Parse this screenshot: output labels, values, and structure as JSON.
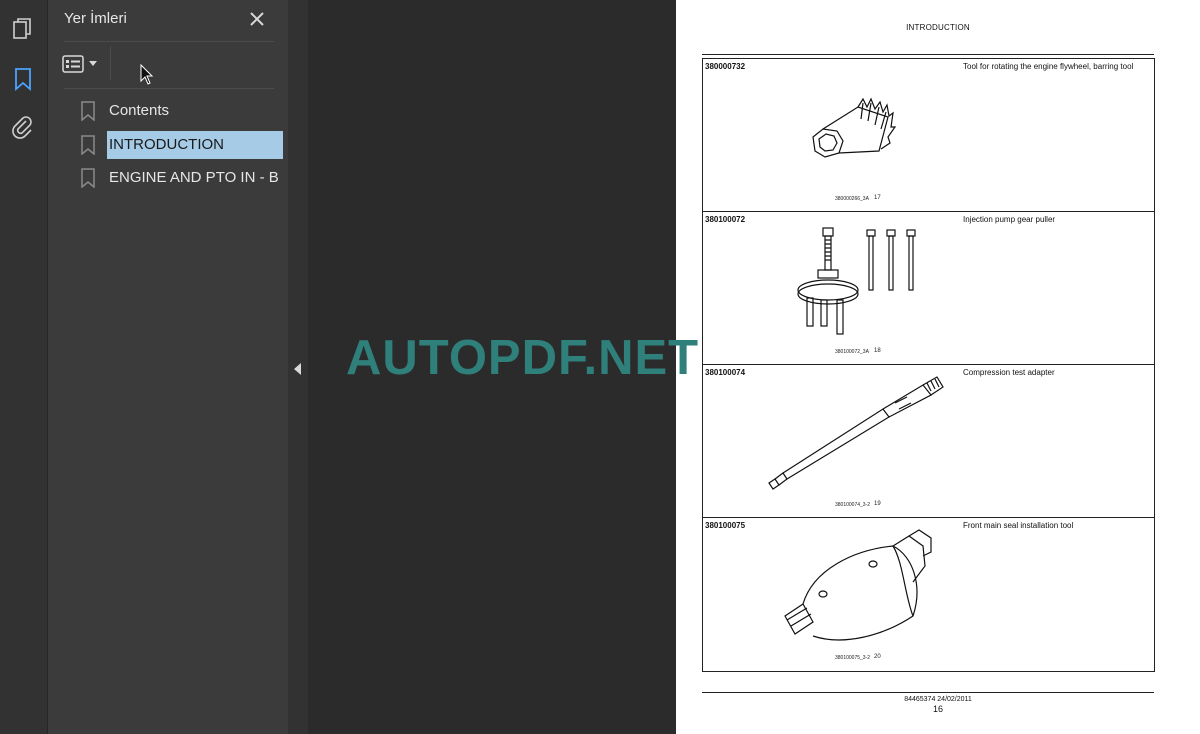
{
  "sidebar_rail": {
    "icons": [
      "pages-icon",
      "bookmark-icon",
      "paperclip-icon"
    ],
    "active": "bookmark-icon",
    "accent_color": "#4aa3ff"
  },
  "bookmarks_panel": {
    "title": "Yer İmleri",
    "items": [
      {
        "label": "Contents"
      },
      {
        "label": "INTRODUCTION",
        "selected": true
      },
      {
        "label": "ENGINE AND PTO IN - B"
      }
    ],
    "selection_color": "#a6cbe6"
  },
  "document": {
    "header": "INTRODUCTION",
    "tools": [
      {
        "code": "380000732",
        "description": "Tool for rotating the engine flywheel, barring tool",
        "fig_caption": "380000266_3A",
        "fig_number": "17"
      },
      {
        "code": "380100072",
        "description": "Injection pump gear puller",
        "fig_caption": "380100072_3A",
        "fig_number": "18"
      },
      {
        "code": "380100074",
        "description": "Compression test adapter",
        "fig_caption": "380100074_3-2",
        "fig_number": "19"
      },
      {
        "code": "380100075",
        "description": "Front main seal installation tool",
        "fig_caption": "380100075_3-2",
        "fig_number": "20"
      }
    ],
    "doc_ref": "84465374 24/02/2011",
    "page_number": "16"
  },
  "watermark": {
    "text": "AUTOPDF.NET",
    "color": "#2f7f7b"
  }
}
